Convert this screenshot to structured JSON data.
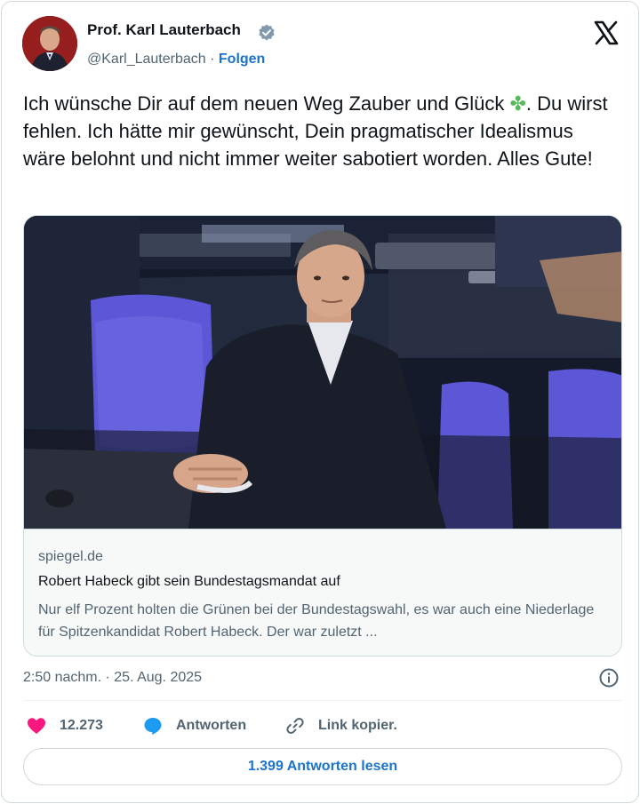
{
  "author": {
    "name": "Prof. Karl Lauterbach",
    "handle": "@Karl_Lauterbach",
    "separator": "·",
    "follow_label": "Folgen"
  },
  "tweet": {
    "text_before_emoji": "Ich wünsche Dir auf dem neuen Weg Zauber und Glück ",
    "emoji": "✤",
    "text_after_emoji": ". Du wirst fehlen. Ich hätte mir gewünscht, Dein pragmatischer Idealismus wäre belohnt und nicht immer weiter sabotiert worden. Alles Gute!"
  },
  "link_card": {
    "domain": "spiegel.de",
    "title": "Robert Habeck gibt sein Bundestagsmandat auf",
    "description": "Nur elf Prozent holten die Grünen bei der Bundestagswahl, es war auch eine Niederlage für Spitzenkandidat Robert Habeck. Der war zuletzt ..."
  },
  "timestamp": "2:50 nachm. · 25. Aug. 2025",
  "actions": {
    "likes": "12.273",
    "reply_label": "Antworten",
    "copy_label": "Link kopier."
  },
  "read_replies_label": "1.399 Antworten lesen",
  "icons": [
    "verified-badge-icon",
    "x-logo-icon",
    "info-icon",
    "heart-icon",
    "reply-bubble-icon",
    "link-icon"
  ],
  "colors": {
    "accent": "#1d73c9",
    "like": "#f91880",
    "reply": "#1d9bf0",
    "muted": "#536471",
    "border": "#cfd9de"
  }
}
